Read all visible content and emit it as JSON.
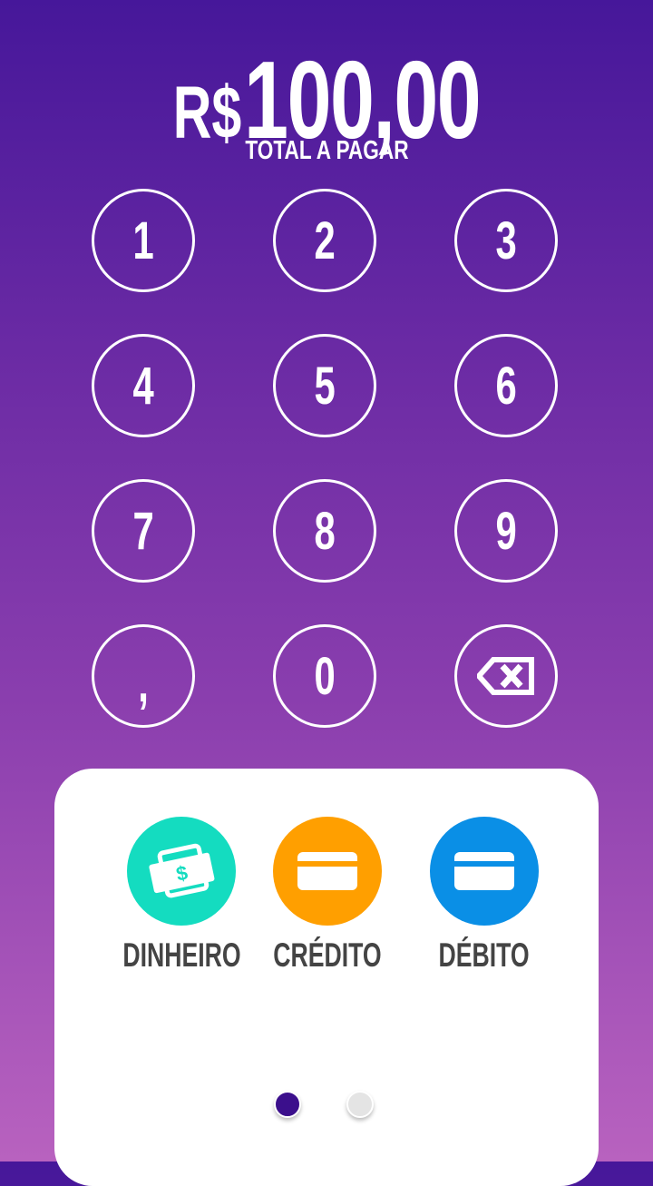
{
  "header": {
    "currency": "R$",
    "amount": "100,00",
    "label": "TOTAL A PAGAR"
  },
  "keypad": {
    "keys": [
      "1",
      "2",
      "3",
      "4",
      "5",
      "6",
      "7",
      "8",
      "9",
      ",",
      "0"
    ],
    "backspace_icon": "backspace-icon"
  },
  "payment_methods": [
    {
      "label": "DINHEIRO",
      "icon": "cash-icon",
      "color": "#14dcc0"
    },
    {
      "label": "CRÉDITO",
      "icon": "credit-card-icon",
      "color": "#ff9f00"
    },
    {
      "label": "DÉBITO",
      "icon": "debit-card-icon",
      "color": "#0a8fe6"
    }
  ],
  "pagination": {
    "pages": 2,
    "current": 1,
    "active_color": "#3b0f8c",
    "inactive_color": "#e4e4e4"
  }
}
